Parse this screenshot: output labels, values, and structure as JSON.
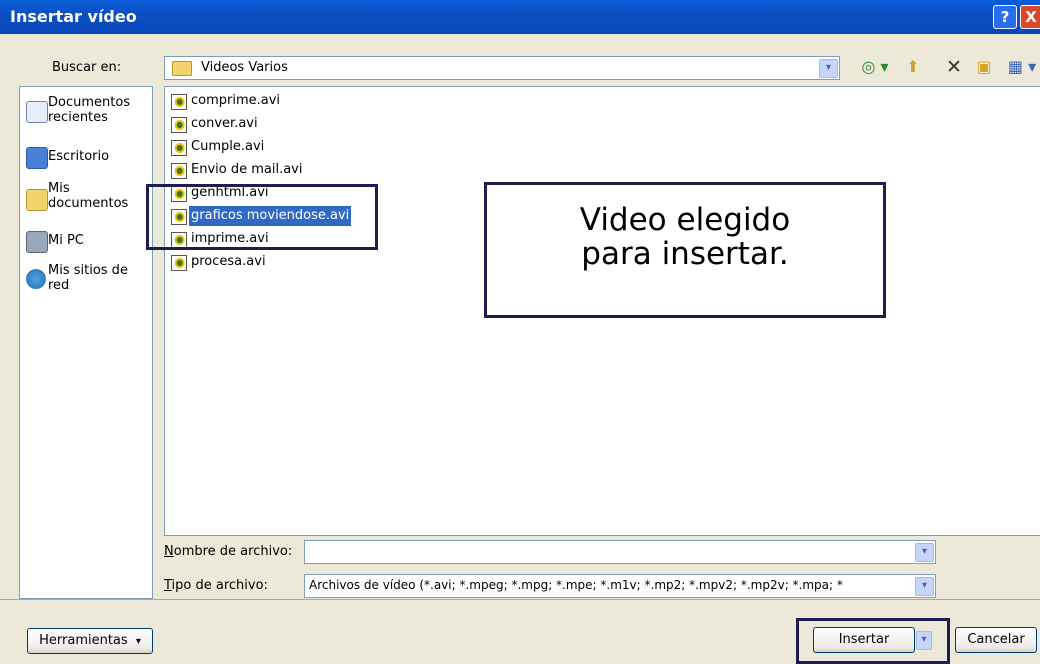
{
  "window": {
    "title": "Insertar vídeo",
    "help_glyph": "?",
    "close_glyph": "X"
  },
  "toolbar": {
    "look_in_label": "Buscar en:",
    "look_in_value": "Videos Varios",
    "back_glyph": "◎ ▾",
    "up_glyph": "⬆",
    "delete_glyph": "✕",
    "newfolder_glyph": "▣",
    "views_glyph": "▦ ▾"
  },
  "places": [
    {
      "label": "Documentos\nrecientes"
    },
    {
      "label": "Escritorio"
    },
    {
      "label": "Mis\ndocumentos"
    },
    {
      "label": "Mi PC"
    },
    {
      "label": "Mis sitios de\nred"
    }
  ],
  "files": [
    {
      "name": "comprime.avi",
      "selected": false
    },
    {
      "name": "conver.avi",
      "selected": false
    },
    {
      "name": "Cumple.avi",
      "selected": false
    },
    {
      "name": "Envio de mail.avi",
      "selected": false
    },
    {
      "name": "genhtml.avi",
      "selected": false
    },
    {
      "name": "graficos moviendose.avi",
      "selected": true
    },
    {
      "name": "imprime.avi",
      "selected": false
    },
    {
      "name": "procesa.avi",
      "selected": false
    }
  ],
  "annotation": {
    "text_line1": "Video elegido",
    "text_line2": "para insertar."
  },
  "filename": {
    "label": "Nombre de archivo:",
    "value": ""
  },
  "filetype": {
    "label": "Tipo de archivo:",
    "value": "Archivos de vídeo (*.avi; *.mpeg; *.mpg; *.mpe; *.m1v; *.mp2; *.mpv2; *.mp2v; *.mpa; *"
  },
  "buttons": {
    "tools": "Herramientas",
    "insert": "Insertar",
    "cancel": "Cancelar",
    "dropdown_glyph": "▾"
  }
}
